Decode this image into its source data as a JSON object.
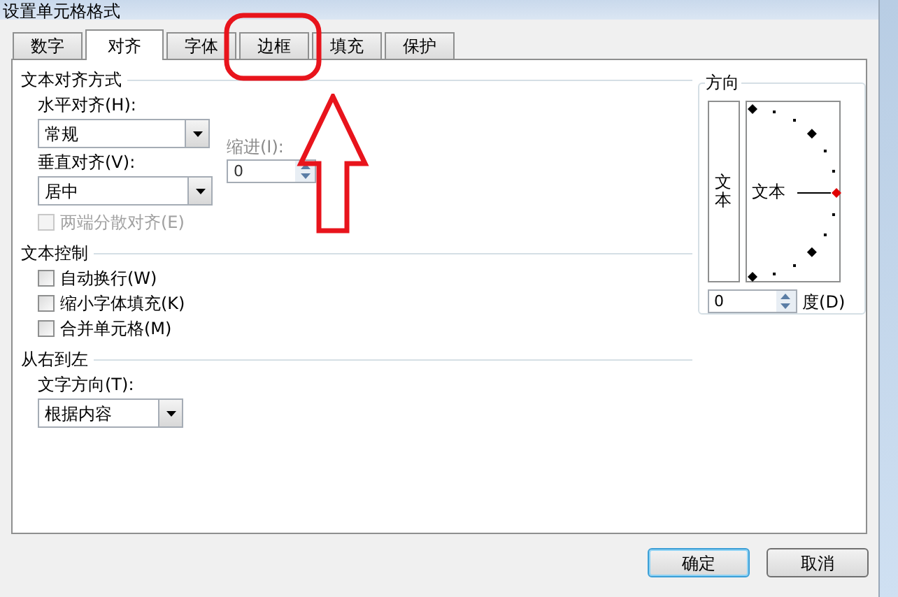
{
  "window": {
    "title": "设置单元格格式"
  },
  "tabs": [
    {
      "label": "数字",
      "selected": false
    },
    {
      "label": "对齐",
      "selected": true
    },
    {
      "label": "字体",
      "selected": false
    },
    {
      "label": "边框",
      "selected": false
    },
    {
      "label": "填充",
      "selected": false
    },
    {
      "label": "保护",
      "selected": false
    }
  ],
  "alignment": {
    "heading": "文本对齐方式",
    "horizontal": {
      "label": "水平对齐(H):",
      "value": "常规"
    },
    "vertical": {
      "label": "垂直对齐(V):",
      "value": "居中"
    },
    "indent": {
      "label": "缩进(I):",
      "value": "0",
      "disabled": true
    },
    "distributed": {
      "label": "两端分散对齐(E)",
      "checked": false,
      "disabled": true
    }
  },
  "text_control": {
    "heading": "文本控制",
    "options": [
      {
        "label": "自动换行(W)",
        "checked": false,
        "disabled": false
      },
      {
        "label": "缩小字体填充(K)",
        "checked": false,
        "disabled": false
      },
      {
        "label": "合并单元格(M)",
        "checked": false,
        "disabled": false
      }
    ]
  },
  "rtl": {
    "heading": "从右到左",
    "direction": {
      "label": "文字方向(T):",
      "value": "根据内容"
    }
  },
  "orientation": {
    "heading": "方向",
    "vertical_text": "文本",
    "dial_text": "文本",
    "degrees": {
      "value": "0",
      "label": "度(D)"
    }
  },
  "buttons": [
    {
      "label": "确定",
      "default": true
    },
    {
      "label": "取消",
      "default": false
    }
  ]
}
